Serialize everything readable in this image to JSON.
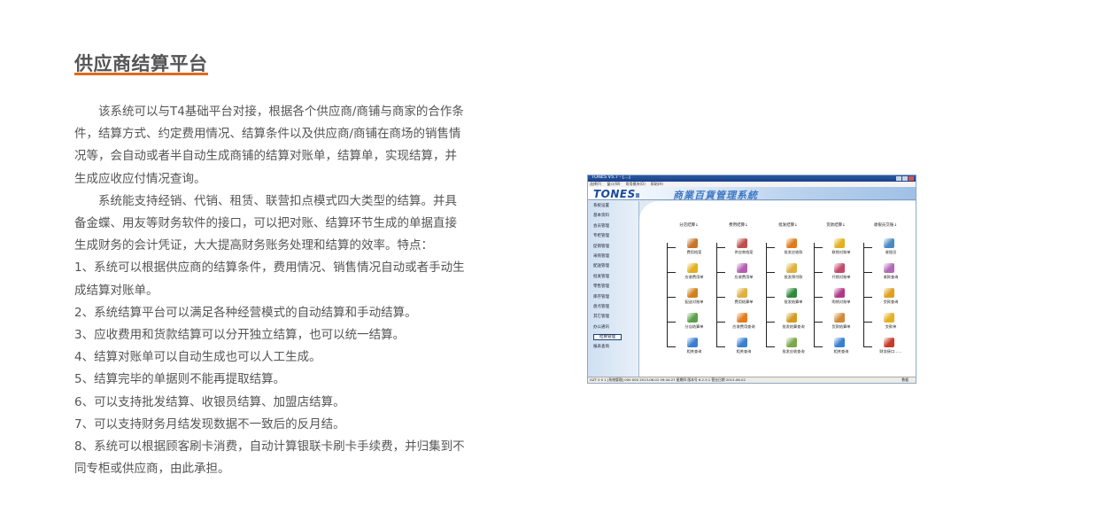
{
  "heading": "供应商结算平台",
  "paragraphs": [
    {
      "text": "该系统可以与T4基础平台对接，根据各个供应商/商铺与商家的合作条件，结算方式、约定费用情况、结算条件以及供应商/商铺在商场的销售情况等，会自动或者半自动生成商铺的结算对账单，结算单，实现结算，并生成应收应付情况查询。",
      "indent": true
    },
    {
      "text": "系统能支持经销、代销、租赁、联营扣点模式四大类型的结算。并具备金蝶、用友等财务软件的接口，可以把对账、结算环节生成的单据直接生成财务的会计凭证，大大提高财务账务处理和结算的效率。特点：",
      "indent": true
    },
    {
      "text": "1、系统可以根据供应商的结算条件，费用情况、销售情况自动或者手动生成结算对账单。",
      "indent": false
    },
    {
      "text": "2、系统结算平台可以满足各种经营模式的自动结算和手动结算。",
      "indent": false
    },
    {
      "text": "3、应收费用和货款结算可以分开独立结算，也可以统一结算。",
      "indent": false
    },
    {
      "text": "4、结算对账单可以自动生成也可以人工生成。",
      "indent": false
    },
    {
      "text": "5、结算完毕的单据则不能再提取结算。",
      "indent": false
    },
    {
      "text": "6、可以支持批发结算、收银员结算、加盟店结算。",
      "indent": false
    },
    {
      "text": "7、可以支持财务月结发现数据不一致后的反月结。",
      "indent": false
    },
    {
      "text": "8、系统可以根据顾客刷卡消费，自动计算银联卡刷卡手续费，并归集到不同专柜或供应商，由此承担。",
      "indent": false
    }
  ],
  "screenshot": {
    "window_title": "TONES V5.7 - [...]",
    "menu": [
      "选择(F)",
      "窗口(W)",
      "常用模块(O)",
      "帮助(H)"
    ],
    "logo": "TONES",
    "logo_suffix": "Ⅱ",
    "banner_title": "商業百貨管理系統",
    "sidebar": [
      "系统设置",
      "基本资料",
      "会员管理",
      "专柜管理",
      "促销管理",
      "采购管理",
      "配送管理",
      "批发管理",
      "零售管理",
      "库存管理",
      "盘点管理",
      "其它管理",
      "办公通讯",
      "结算管理",
      "报表查询"
    ],
    "sidebar_active_index": 13,
    "columns": [
      {
        "head": "分店结算↓",
        "items": [
          {
            "label": "费用档案",
            "icon": "books-icon",
            "color": "#c8742a"
          },
          {
            "label": "应收费用单",
            "icon": "folder-icon",
            "color": "#e3b020"
          },
          {
            "label": "配送对账单",
            "icon": "crate-icon",
            "color": "#d1821c"
          },
          {
            "label": "分店结算单",
            "icon": "cube-icon",
            "color": "#5aa04a"
          },
          {
            "label": "相关查询",
            "icon": "magnifier-icon",
            "color": "#3a7fd0"
          }
        ]
      },
      {
        "head": "费用结算↓",
        "items": [
          {
            "label": "供应商档案",
            "icon": "people-icon",
            "color": "#c0504d"
          },
          {
            "label": "应收费用单",
            "icon": "card-icon",
            "color": "#b35fb0"
          },
          {
            "label": "费用结算单",
            "icon": "pen-icon",
            "color": "#e0b040"
          },
          {
            "label": "应收费用查询",
            "icon": "box-icon",
            "color": "#e37c1c"
          },
          {
            "label": "相关查询",
            "icon": "magnifier-icon",
            "color": "#3a7fd0"
          }
        ]
      },
      {
        "head": "批发结算↓",
        "items": [
          {
            "label": "批发应收款",
            "icon": "flag-icon",
            "color": "#e07a1a"
          },
          {
            "label": "批发预付款",
            "icon": "pen-icon",
            "color": "#e0b040"
          },
          {
            "label": "批发结算单",
            "icon": "disc-icon",
            "color": "#2f8a3a"
          },
          {
            "label": "批发结算查询",
            "icon": "stack-icon",
            "color": "#d49a22"
          },
          {
            "label": "批发应收查询",
            "icon": "stack-icon",
            "color": "#7aa84a"
          }
        ]
      },
      {
        "head": "货款结算↓",
        "items": [
          {
            "label": "联销对账单",
            "icon": "coins-icon",
            "color": "#e3b020"
          },
          {
            "label": "代销对账单",
            "icon": "book-icon",
            "color": "#c24a6a"
          },
          {
            "label": "购销对账单",
            "icon": "book-icon",
            "color": "#b03a8a"
          },
          {
            "label": "货款结算单",
            "icon": "hand-icon",
            "color": "#d08a3a"
          },
          {
            "label": "相关查询",
            "icon": "magnifier-icon",
            "color": "#3a7fd0"
          }
        ]
      },
      {
        "head": "收银员交账↓",
        "items": [
          {
            "label": "收银员",
            "icon": "users-icon",
            "color": "#4a8ac4"
          },
          {
            "label": "收款查询",
            "icon": "chart-icon",
            "color": "#b06ab8"
          },
          {
            "label": "交款查询",
            "icon": "globe-icon",
            "color": "#e0a020"
          },
          {
            "label": "交款单",
            "icon": "money-icon",
            "color": "#e3b020"
          },
          {
            "label": "财务接口……",
            "icon": "pens-icon",
            "color": "#c83a2a"
          }
        ]
      }
    ],
    "statusbar": "GZT 0 0 1    [系统管理]    000  000  2013-06-02 09:44:27    星期四    版本号 6.2.3.1    营业日期  2013-06-02",
    "statusbar_right": "数据"
  }
}
